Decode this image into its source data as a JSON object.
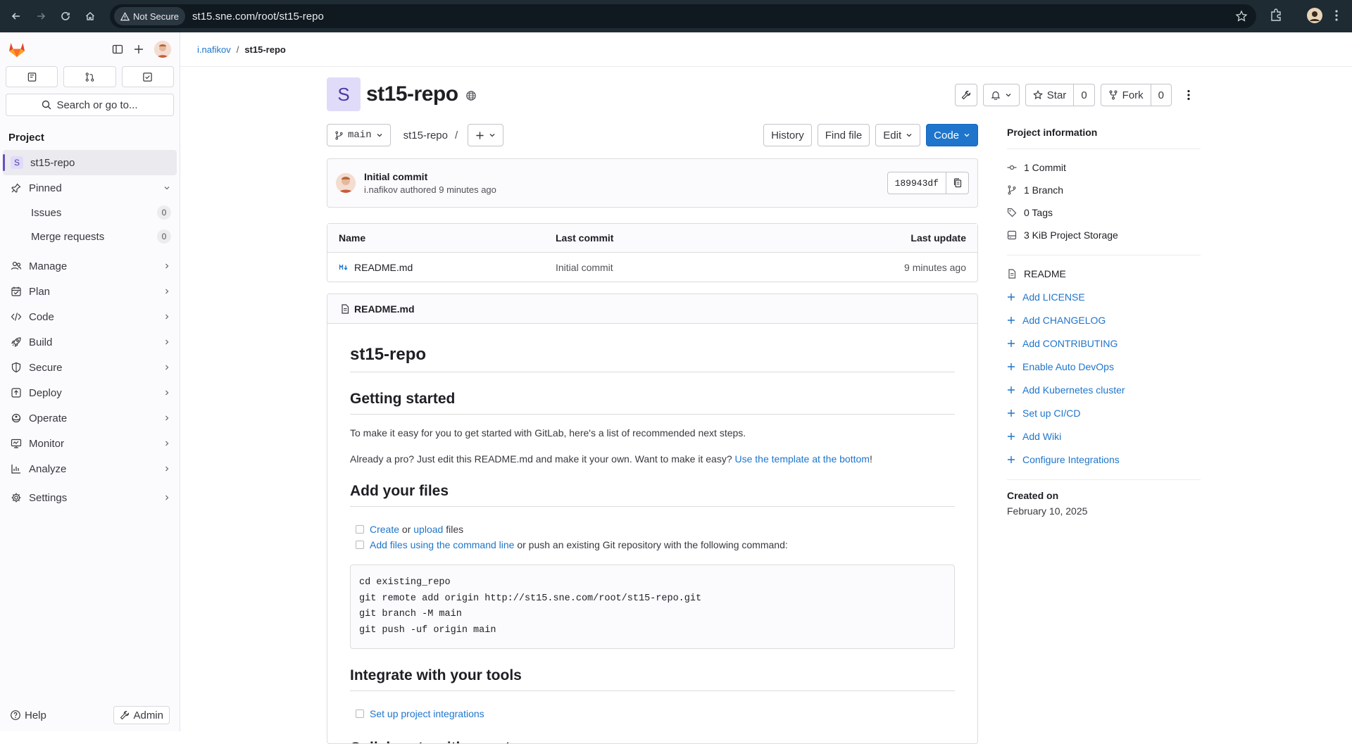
{
  "browser": {
    "security_label": "Not Secure",
    "url": "st15.sne.com/root/st15-repo"
  },
  "sidebar": {
    "search_label": "Search or go to...",
    "section_title": "Project",
    "project_initial": "S",
    "project_name": "st15-repo",
    "pinned_label": "Pinned",
    "pinned_items": [
      {
        "label": "Issues",
        "count": "0"
      },
      {
        "label": "Merge requests",
        "count": "0"
      }
    ],
    "nav_items": [
      {
        "label": "Manage",
        "icon": "users-icon"
      },
      {
        "label": "Plan",
        "icon": "calendar-icon"
      },
      {
        "label": "Code",
        "icon": "code-icon"
      },
      {
        "label": "Build",
        "icon": "rocket-icon"
      },
      {
        "label": "Secure",
        "icon": "shield-icon"
      },
      {
        "label": "Deploy",
        "icon": "deploy-icon"
      },
      {
        "label": "Operate",
        "icon": "operate-icon"
      },
      {
        "label": "Monitor",
        "icon": "monitor-icon"
      },
      {
        "label": "Analyze",
        "icon": "chart-icon"
      }
    ],
    "settings_label": "Settings",
    "help_label": "Help",
    "admin_label": "Admin"
  },
  "breadcrumb": {
    "parent": "i.nafikov",
    "separator": "/",
    "current": "st15-repo"
  },
  "project": {
    "initial": "S",
    "title": "st15-repo",
    "star_label": "Star",
    "star_count": "0",
    "fork_label": "Fork",
    "fork_count": "0"
  },
  "toolbar": {
    "branch": "main",
    "path": "st15-repo",
    "path_sep": "/",
    "history_label": "History",
    "find_file_label": "Find file",
    "edit_label": "Edit",
    "code_label": "Code"
  },
  "last_commit": {
    "title": "Initial commit",
    "author_line": "i.nafikov authored 9 minutes ago",
    "sha": "189943df"
  },
  "file_table": {
    "headers": {
      "name": "Name",
      "last_commit": "Last commit",
      "last_update": "Last update"
    },
    "rows": [
      {
        "name": "README.md",
        "last_commit": "Initial commit",
        "last_update": "9 minutes ago"
      }
    ]
  },
  "readme": {
    "file_name": "README.md",
    "h1": "st15-repo",
    "getting_started": "Getting started",
    "p1": "To make it easy for you to get started with GitLab, here's a list of recommended next steps.",
    "p2_text": "Already a pro? Just edit this README.md and make it your own. Want to make it easy? ",
    "p2_link": "Use the template at the bottom",
    "p2_end": "!",
    "add_files": "Add your files",
    "task1_create": "Create",
    "task1_or": " or ",
    "task1_upload": "upload",
    "task1_files": " files",
    "task2_link": "Add files using the command line",
    "task2_text": " or push an existing Git repository with the following command:",
    "code": "cd existing_repo\ngit remote add origin http://st15.sne.com/root/st15-repo.git\ngit branch -M main\ngit push -uf origin main",
    "integrate": "Integrate with your tools",
    "task3_link": "Set up project integrations",
    "collab": "Collaborate with your team"
  },
  "project_info": {
    "title": "Project information",
    "stats": [
      {
        "label": "1 Commit",
        "icon": "commit-icon"
      },
      {
        "label": "1 Branch",
        "icon": "branch-icon"
      },
      {
        "label": "0 Tags",
        "icon": "tag-icon"
      },
      {
        "label": "3 KiB Project Storage",
        "icon": "storage-icon"
      }
    ],
    "readme_label": "README",
    "links": [
      "Add LICENSE",
      "Add CHANGELOG",
      "Add CONTRIBUTING",
      "Enable Auto DevOps",
      "Add Kubernetes cluster",
      "Set up CI/CD",
      "Add Wiki",
      "Configure Integrations"
    ],
    "created_label": "Created on",
    "created_value": "February 10, 2025"
  }
}
